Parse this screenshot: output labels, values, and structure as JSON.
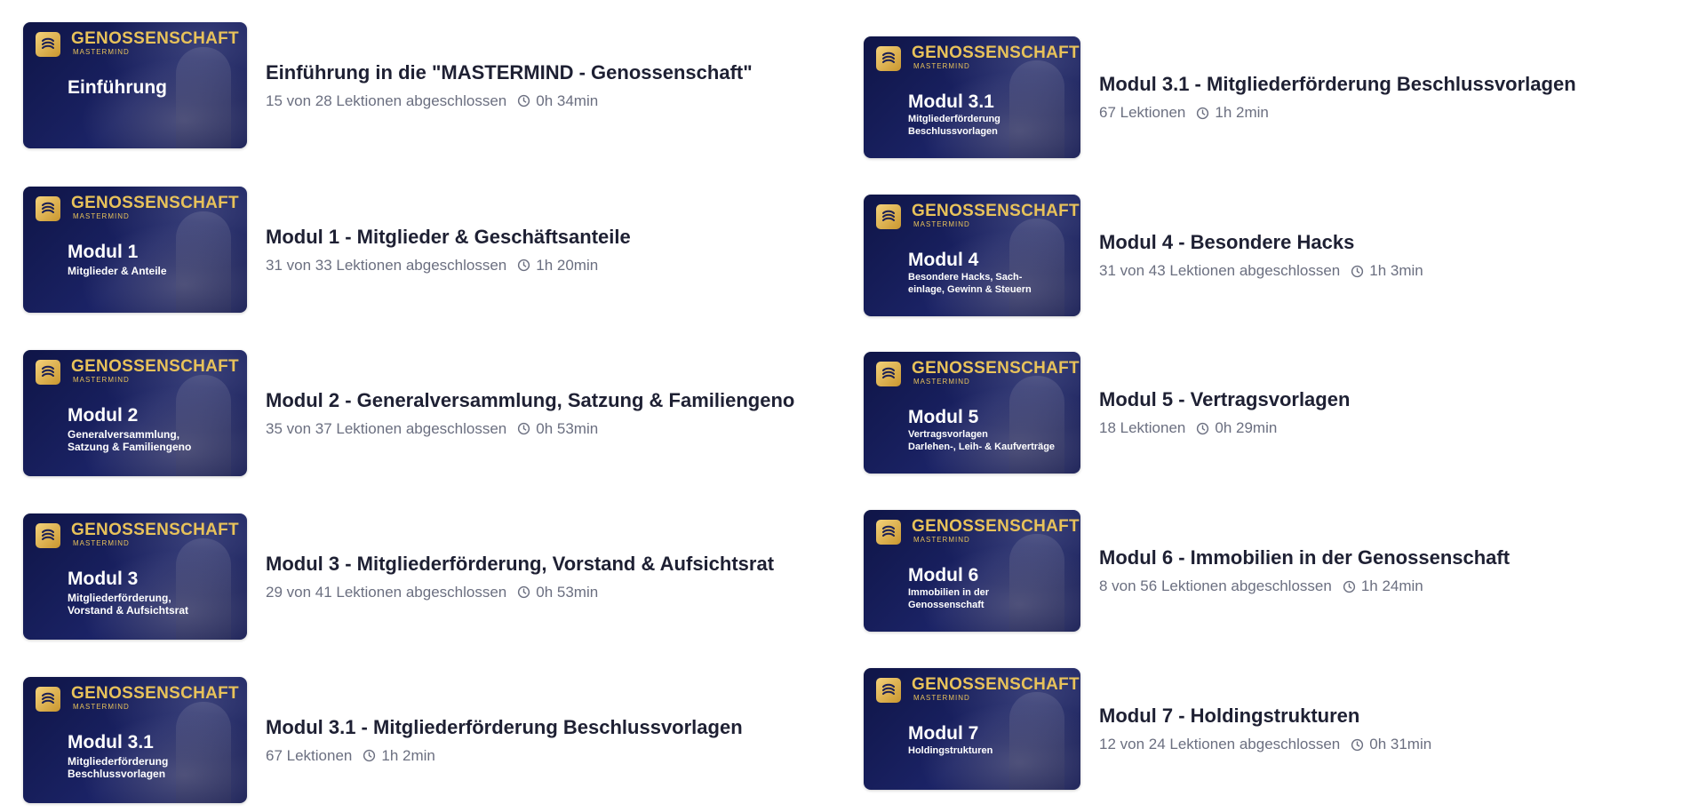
{
  "brand": {
    "name": "GENOSSENSCHAFT",
    "sub": "MASTERMIND"
  },
  "left": [
    {
      "thumb_title": "Einführung",
      "thumb_sub": "",
      "title": "Einführung in die \"MASTERMIND - Genossenschaft\"",
      "progress": "15 von 28 Lektionen abgeschlossen",
      "duration": "0h 34min"
    },
    {
      "thumb_title": "Modul 1",
      "thumb_sub": "Mitglieder & Anteile",
      "title": "Modul 1 - Mitglieder & Geschäftsanteile",
      "progress": "31 von 33 Lektionen abgeschlossen",
      "duration": "1h 20min"
    },
    {
      "thumb_title": "Modul 2",
      "thumb_sub": "Generalversammlung,\nSatzung & Familiengeno",
      "title": "Modul 2 - Generalversammlung, Satzung & Familiengeno",
      "progress": "35 von 37 Lektionen abgeschlossen",
      "duration": "0h 53min"
    },
    {
      "thumb_title": "Modul 3",
      "thumb_sub": "Mitgliederförderung,\nVorstand & Aufsichtsrat",
      "title": "Modul 3 - Mitgliederförderung, Vorstand & Aufsichtsrat",
      "progress": "29 von 41 Lektionen abgeschlossen",
      "duration": "0h 53min"
    },
    {
      "thumb_title": "Modul 3.1",
      "thumb_sub": "Mitgliederförderung\nBeschlussvorlagen",
      "title": "Modul 3.1 - Mitgliederförderung Beschlussvorlagen",
      "progress": "67 Lektionen",
      "duration": "1h 2min"
    }
  ],
  "right": [
    {
      "thumb_title": "Modul 3.1",
      "thumb_sub": "Mitgliederförderung\nBeschlussvorlagen",
      "title": "Modul 3.1 - Mitgliederförderung Beschlussvorlagen",
      "progress": "67 Lektionen",
      "duration": "1h 2min"
    },
    {
      "thumb_title": "Modul 4",
      "thumb_sub": "Besondere Hacks, Sach-\neinlage, Gewinn & Steuern",
      "title": "Modul 4 - Besondere Hacks",
      "progress": "31 von 43 Lektionen abgeschlossen",
      "duration": "1h 3min"
    },
    {
      "thumb_title": "Modul 5",
      "thumb_sub": "Vertragsvorlagen\nDarlehen-, Leih- & Kaufverträge",
      "title": "Modul 5 - Vertragsvorlagen",
      "progress": "18 Lektionen",
      "duration": "0h 29min"
    },
    {
      "thumb_title": "Modul 6",
      "thumb_sub": "Immobilien in der\nGenossenschaft",
      "title": "Modul 6 - Immobilien in der Genossenschaft",
      "progress": "8 von 56 Lektionen abgeschlossen",
      "duration": "1h 24min"
    },
    {
      "thumb_title": "Modul 7",
      "thumb_sub": "Holdingstrukturen",
      "title": "Modul 7 - Holdingstrukturen",
      "progress": "12 von 24 Lektionen abgeschlossen",
      "duration": "0h 31min"
    }
  ]
}
